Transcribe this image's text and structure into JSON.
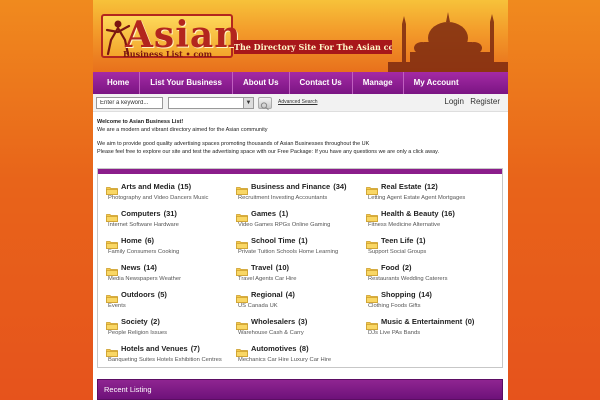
{
  "header": {
    "logo_title": "Asian",
    "logo_subtitle": "Business List • com",
    "tagline": "The Directory Site For The Asian community"
  },
  "colors": {
    "accent": "#7a1583",
    "background": "#e8641a",
    "header": "#f39a2a"
  },
  "nav": {
    "items": [
      {
        "label": "Home"
      },
      {
        "label": "List Your Business"
      },
      {
        "label": "About Us"
      },
      {
        "label": "Contact Us"
      },
      {
        "label": "Manage"
      },
      {
        "label": "My Account"
      }
    ]
  },
  "search": {
    "keyword_placeholder": "Enter a keyword...",
    "advanced_label": "Advanced Search"
  },
  "auth": {
    "login": "Login",
    "register": "Register"
  },
  "intro": {
    "welcome": "Welcome to Asian Business List!",
    "line1": "We are a modern and vibrant directory aimed for the Asian community",
    "line2": "We aim to provide good quality advertising spaces promoting thousands of Asian Businesses throughout the UK",
    "line3": "Please feel free to explore our site and test the advertising space with our Free Package: If you have any questions we are only a click away."
  },
  "categories": [
    {
      "name": "Arts and Media",
      "count": "(15)",
      "subs": "Photography and Video Dancers Music"
    },
    {
      "name": "Business and Finance",
      "count": "(34)",
      "subs": "Recruitment Investing Accountants"
    },
    {
      "name": "Real Estate",
      "count": "(12)",
      "subs": "Letting Agent Estate Agent Mortgages"
    },
    {
      "name": "Computers",
      "count": "(31)",
      "subs": "Internet Software Hardware"
    },
    {
      "name": "Games",
      "count": "(1)",
      "subs": "Video Games RPGs Online Gaming"
    },
    {
      "name": "Health & Beauty",
      "count": "(16)",
      "subs": "Fitness Medicine Alternative"
    },
    {
      "name": "Home",
      "count": "(6)",
      "subs": "Family Consumers Cooking"
    },
    {
      "name": "School Time",
      "count": "(1)",
      "subs": "Private Tuition Schools Home Learning"
    },
    {
      "name": "Teen Life",
      "count": "(1)",
      "subs": "Support Social Groups"
    },
    {
      "name": "News",
      "count": "(14)",
      "subs": "Media Newspapers Weather"
    },
    {
      "name": "Travel",
      "count": "(10)",
      "subs": "Travel Agents Car Hire"
    },
    {
      "name": "Food",
      "count": "(2)",
      "subs": "Restaurants Wedding Caterers"
    },
    {
      "name": "Outdoors",
      "count": "(5)",
      "subs": "Events"
    },
    {
      "name": "Regional",
      "count": "(4)",
      "subs": "US Canada UK"
    },
    {
      "name": "Shopping",
      "count": "(14)",
      "subs": "Clothing Foods Gifts"
    },
    {
      "name": "Society",
      "count": "(2)",
      "subs": "People Religion Issues"
    },
    {
      "name": "Wholesalers",
      "count": "(3)",
      "subs": "Warehouse Cash & Carry"
    },
    {
      "name": "Music & Entertainment",
      "count": "(0)",
      "subs": "DJs Live PAs Bands"
    },
    {
      "name": "Hotels and Venues",
      "count": "(7)",
      "subs": "Banqueting Suites Hotels Exhibition Centres"
    },
    {
      "name": "Automotives",
      "count": "(8)",
      "subs": "Mechanics Car Hire Luxury Car Hire"
    }
  ],
  "recent": {
    "title": "Recent Listing"
  },
  "icons": {
    "category": "folder-icon",
    "search_go": "magnifier-icon",
    "dropdown": "chevron-down-icon"
  }
}
